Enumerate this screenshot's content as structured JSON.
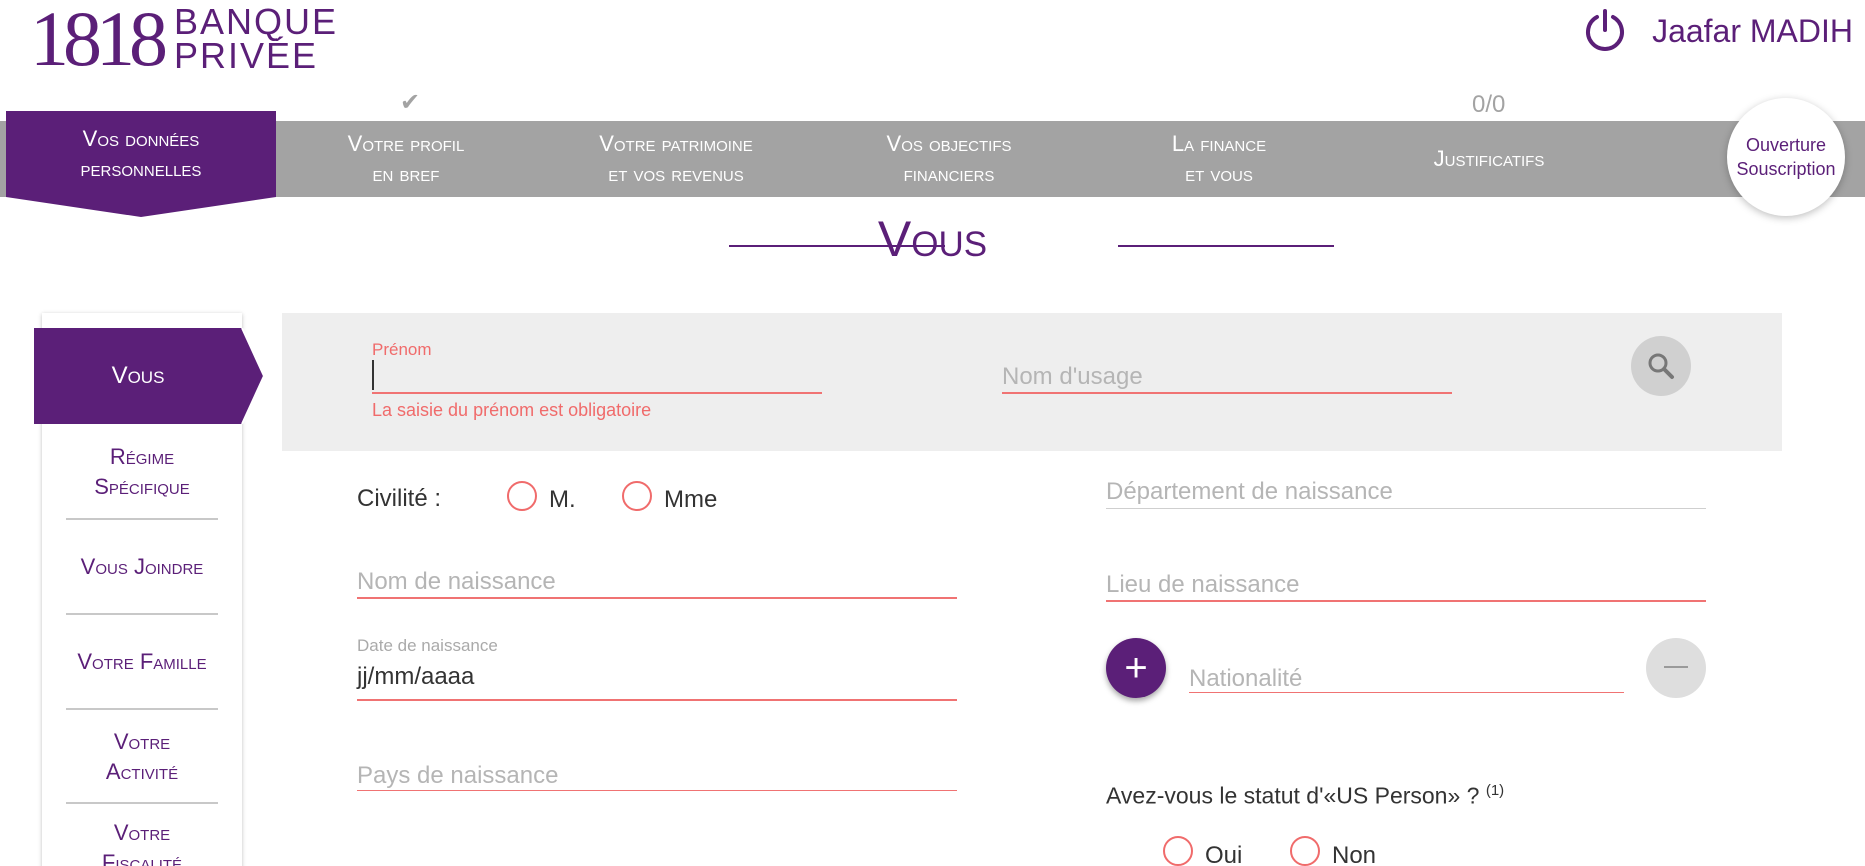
{
  "brand": {
    "number": "1818",
    "name_line1": "BANQUE",
    "name_line2": "PRIVÉE",
    "color": "#5b1f78"
  },
  "user": {
    "name": "Jaafar MADIH",
    "icon": "power-icon"
  },
  "top_nav": {
    "items": [
      {
        "line1": "Vos données",
        "line2": "personnelles",
        "active": true
      },
      {
        "line1": "Votre profil",
        "line2": "en bref",
        "completed": true
      },
      {
        "line1": "Votre patrimoine",
        "line2": "et vos revenus"
      },
      {
        "line1": "Vos objectifs",
        "line2": "financiers"
      },
      {
        "line1": "La finance",
        "line2": "et vous"
      },
      {
        "line1": "Justificatifs",
        "line2": ""
      }
    ],
    "counter": "0/0",
    "ouverture_line1": "Ouverture",
    "ouverture_line2": "Souscription"
  },
  "section": {
    "title": "Vous"
  },
  "side_nav": {
    "active": "Vous",
    "items": [
      {
        "line1": "Régime",
        "line2": "Spécifique"
      },
      {
        "line1": "Vous Joindre",
        "line2": ""
      },
      {
        "line1": "Votre Famille",
        "line2": ""
      },
      {
        "line1": "Votre",
        "line2": "Activité"
      },
      {
        "line1": "Votre",
        "line2": "Fiscalité"
      }
    ]
  },
  "form": {
    "prenom_label": "Prénom",
    "prenom_value": "",
    "prenom_error": "La saisie du prénom est obligatoire",
    "nom_usage_placeholder": "Nom d'usage",
    "civilite_label": "Civilité :",
    "civilite_options": [
      "M.",
      "Mme"
    ],
    "nom_naissance_placeholder": "Nom de naissance",
    "date_naissance_label": "Date de naissance",
    "date_naissance_value": "jj/mm/aaaa",
    "pays_naissance_placeholder": "Pays de naissance",
    "departement_placeholder": "Département de naissance",
    "lieu_placeholder": "Lieu de naissance",
    "nationalite_placeholder": "Nationalité",
    "us_person_question": "Avez-vous le statut d'«US Person» ?",
    "us_person_footnote": "(1)",
    "us_person_options": [
      "Oui",
      "Non"
    ]
  },
  "colors": {
    "accent": "#5b1f78",
    "nav_gray": "#a3a3a3",
    "error": "#f06b6b",
    "panel": "#eeeeee"
  }
}
